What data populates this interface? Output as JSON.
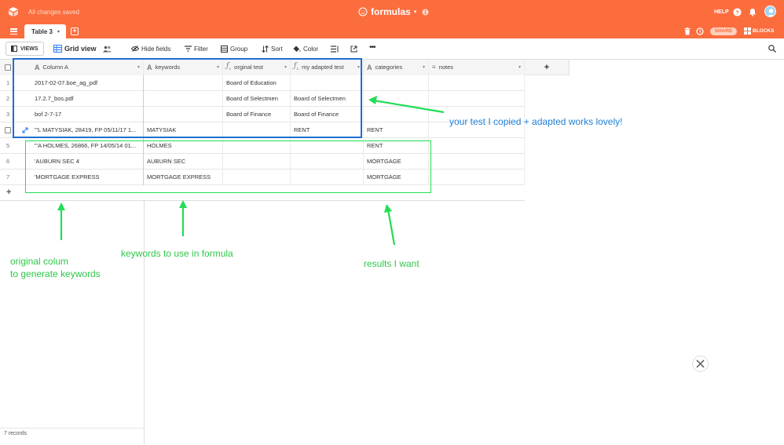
{
  "topbar": {
    "status": "All changes saved",
    "title": "formulas",
    "help": "HELP",
    "share": "SHARE",
    "blocks": "BLOCKS"
  },
  "tabs": {
    "active": "Table 3"
  },
  "toolbar": {
    "views": "VIEWS",
    "view_name": "Grid view",
    "hide_fields": "Hide fields",
    "filter": "Filter",
    "group": "Group",
    "sort": "Sort",
    "color": "Color"
  },
  "columns": [
    "Column A",
    "keywords",
    "orginal test",
    "my adapted test",
    "categories",
    "notes"
  ],
  "rows": [
    {
      "num": "1",
      "a": "2017-02-07.boe_ag_pdf",
      "kw": "",
      "orig": "Board of Education",
      "adapt": "",
      "cat": ""
    },
    {
      "num": "2",
      "a": "17.2.7_bos.pdf",
      "kw": "",
      "orig": "Board of Selectmen",
      "adapt": "Board of Selectmen",
      "cat": ""
    },
    {
      "num": "3",
      "a": "bof 2-7-17",
      "kw": "",
      "orig": "Board of Finance",
      "adapt": "Board of Finance",
      "cat": ""
    },
    {
      "num": "",
      "a": "\"'L MATYSIAK, 28419, FP 05/11/17 1...",
      "kw": "MATYSIAK",
      "orig": "",
      "adapt": "RENT",
      "cat": "RENT"
    },
    {
      "num": "5",
      "a": "\"'A HOLMES, 26866, FP 14/05/14 01...",
      "kw": "HOLMES",
      "orig": "",
      "adapt": "",
      "cat": "RENT"
    },
    {
      "num": "6",
      "a": "'AUBURN SEC 4",
      "kw": "AUBURN SEC",
      "orig": "",
      "adapt": "",
      "cat": "MORTGAGE"
    },
    {
      "num": "7",
      "a": "'MORTGAGE EXPRESS",
      "kw": "MORTGAGE EXPRESS",
      "orig": "",
      "adapt": "",
      "cat": "MORTGAGE"
    }
  ],
  "footer": {
    "records": "7 records"
  },
  "annotations": {
    "right": "your test I copied + adapted works lovely!",
    "left1": "original colum",
    "left2": "to generate keywords",
    "middle": "keywords to use in formula",
    "results": "results I want"
  },
  "colors": {
    "brand": "#fc6d3e",
    "arrow": "#22dd55",
    "blue_box": "#1f6fd1",
    "note_text": "#1f7fd6",
    "green_text": "#2fc84a"
  }
}
